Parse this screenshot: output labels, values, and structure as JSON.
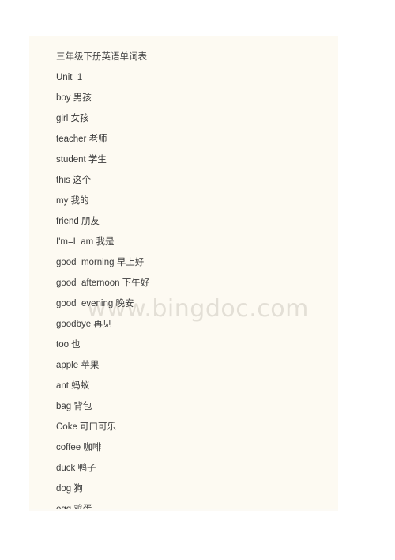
{
  "page": {
    "background_color": "#ffffff",
    "sheet_color": "#fdfaf2",
    "text_color": "#3b3b3b"
  },
  "watermark": {
    "text": "www.bingdoc.com",
    "color": "#e3dfd6"
  },
  "document": {
    "title": "三年级下册英语单词表",
    "lines": [
      {
        "text": "三年级下册英语单词表",
        "kind": "title"
      },
      {
        "text": "Unit  1",
        "kind": "heading"
      },
      {
        "text": "boy 男孩",
        "kind": "entry"
      },
      {
        "text": "girl 女孩",
        "kind": "entry"
      },
      {
        "text": "teacher 老师",
        "kind": "entry"
      },
      {
        "text": "student 学生",
        "kind": "entry"
      },
      {
        "text": "this 这个",
        "kind": "entry"
      },
      {
        "text": "my 我的",
        "kind": "entry"
      },
      {
        "text": "friend 朋友",
        "kind": "entry"
      },
      {
        "text": "I'm=I  am 我是",
        "kind": "entry"
      },
      {
        "text": "good  morning 早上好",
        "kind": "entry"
      },
      {
        "text": "good  afternoon 下午好",
        "kind": "entry"
      },
      {
        "text": "good  evening 晚安",
        "kind": "entry"
      },
      {
        "text": "goodbye 再见",
        "kind": "entry"
      },
      {
        "text": "too 也",
        "kind": "entry"
      },
      {
        "text": "apple 苹果",
        "kind": "entry"
      },
      {
        "text": "ant 蚂蚁",
        "kind": "entry"
      },
      {
        "text": "bag 背包",
        "kind": "entry"
      },
      {
        "text": "Coke 可口可乐",
        "kind": "entry"
      },
      {
        "text": "coffee 咖啡",
        "kind": "entry"
      },
      {
        "text": "duck 鸭子",
        "kind": "entry"
      },
      {
        "text": "dog 狗",
        "kind": "entry"
      },
      {
        "text": "egg 鸡蛋",
        "kind": "entry"
      }
    ]
  }
}
